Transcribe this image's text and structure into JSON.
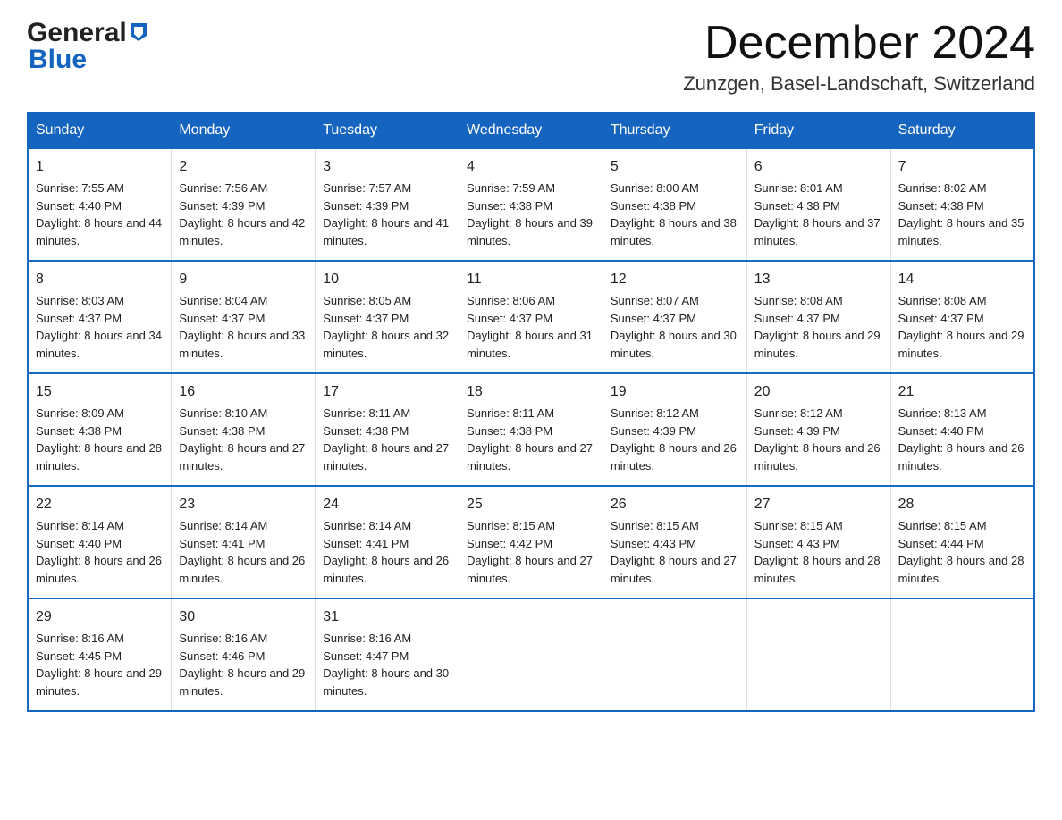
{
  "header": {
    "logo_general": "General",
    "logo_blue": "Blue",
    "month_title": "December 2024",
    "location": "Zunzgen, Basel-Landschaft, Switzerland"
  },
  "days_of_week": [
    "Sunday",
    "Monday",
    "Tuesday",
    "Wednesday",
    "Thursday",
    "Friday",
    "Saturday"
  ],
  "weeks": [
    [
      {
        "day": "1",
        "sunrise": "7:55 AM",
        "sunset": "4:40 PM",
        "daylight": "8 hours and 44 minutes."
      },
      {
        "day": "2",
        "sunrise": "7:56 AM",
        "sunset": "4:39 PM",
        "daylight": "8 hours and 42 minutes."
      },
      {
        "day": "3",
        "sunrise": "7:57 AM",
        "sunset": "4:39 PM",
        "daylight": "8 hours and 41 minutes."
      },
      {
        "day": "4",
        "sunrise": "7:59 AM",
        "sunset": "4:38 PM",
        "daylight": "8 hours and 39 minutes."
      },
      {
        "day": "5",
        "sunrise": "8:00 AM",
        "sunset": "4:38 PM",
        "daylight": "8 hours and 38 minutes."
      },
      {
        "day": "6",
        "sunrise": "8:01 AM",
        "sunset": "4:38 PM",
        "daylight": "8 hours and 37 minutes."
      },
      {
        "day": "7",
        "sunrise": "8:02 AM",
        "sunset": "4:38 PM",
        "daylight": "8 hours and 35 minutes."
      }
    ],
    [
      {
        "day": "8",
        "sunrise": "8:03 AM",
        "sunset": "4:37 PM",
        "daylight": "8 hours and 34 minutes."
      },
      {
        "day": "9",
        "sunrise": "8:04 AM",
        "sunset": "4:37 PM",
        "daylight": "8 hours and 33 minutes."
      },
      {
        "day": "10",
        "sunrise": "8:05 AM",
        "sunset": "4:37 PM",
        "daylight": "8 hours and 32 minutes."
      },
      {
        "day": "11",
        "sunrise": "8:06 AM",
        "sunset": "4:37 PM",
        "daylight": "8 hours and 31 minutes."
      },
      {
        "day": "12",
        "sunrise": "8:07 AM",
        "sunset": "4:37 PM",
        "daylight": "8 hours and 30 minutes."
      },
      {
        "day": "13",
        "sunrise": "8:08 AM",
        "sunset": "4:37 PM",
        "daylight": "8 hours and 29 minutes."
      },
      {
        "day": "14",
        "sunrise": "8:08 AM",
        "sunset": "4:37 PM",
        "daylight": "8 hours and 29 minutes."
      }
    ],
    [
      {
        "day": "15",
        "sunrise": "8:09 AM",
        "sunset": "4:38 PM",
        "daylight": "8 hours and 28 minutes."
      },
      {
        "day": "16",
        "sunrise": "8:10 AM",
        "sunset": "4:38 PM",
        "daylight": "8 hours and 27 minutes."
      },
      {
        "day": "17",
        "sunrise": "8:11 AM",
        "sunset": "4:38 PM",
        "daylight": "8 hours and 27 minutes."
      },
      {
        "day": "18",
        "sunrise": "8:11 AM",
        "sunset": "4:38 PM",
        "daylight": "8 hours and 27 minutes."
      },
      {
        "day": "19",
        "sunrise": "8:12 AM",
        "sunset": "4:39 PM",
        "daylight": "8 hours and 26 minutes."
      },
      {
        "day": "20",
        "sunrise": "8:12 AM",
        "sunset": "4:39 PM",
        "daylight": "8 hours and 26 minutes."
      },
      {
        "day": "21",
        "sunrise": "8:13 AM",
        "sunset": "4:40 PM",
        "daylight": "8 hours and 26 minutes."
      }
    ],
    [
      {
        "day": "22",
        "sunrise": "8:14 AM",
        "sunset": "4:40 PM",
        "daylight": "8 hours and 26 minutes."
      },
      {
        "day": "23",
        "sunrise": "8:14 AM",
        "sunset": "4:41 PM",
        "daylight": "8 hours and 26 minutes."
      },
      {
        "day": "24",
        "sunrise": "8:14 AM",
        "sunset": "4:41 PM",
        "daylight": "8 hours and 26 minutes."
      },
      {
        "day": "25",
        "sunrise": "8:15 AM",
        "sunset": "4:42 PM",
        "daylight": "8 hours and 27 minutes."
      },
      {
        "day": "26",
        "sunrise": "8:15 AM",
        "sunset": "4:43 PM",
        "daylight": "8 hours and 27 minutes."
      },
      {
        "day": "27",
        "sunrise": "8:15 AM",
        "sunset": "4:43 PM",
        "daylight": "8 hours and 28 minutes."
      },
      {
        "day": "28",
        "sunrise": "8:15 AM",
        "sunset": "4:44 PM",
        "daylight": "8 hours and 28 minutes."
      }
    ],
    [
      {
        "day": "29",
        "sunrise": "8:16 AM",
        "sunset": "4:45 PM",
        "daylight": "8 hours and 29 minutes."
      },
      {
        "day": "30",
        "sunrise": "8:16 AM",
        "sunset": "4:46 PM",
        "daylight": "8 hours and 29 minutes."
      },
      {
        "day": "31",
        "sunrise": "8:16 AM",
        "sunset": "4:47 PM",
        "daylight": "8 hours and 30 minutes."
      },
      null,
      null,
      null,
      null
    ]
  ],
  "labels": {
    "sunrise": "Sunrise:",
    "sunset": "Sunset:",
    "daylight": "Daylight:"
  }
}
